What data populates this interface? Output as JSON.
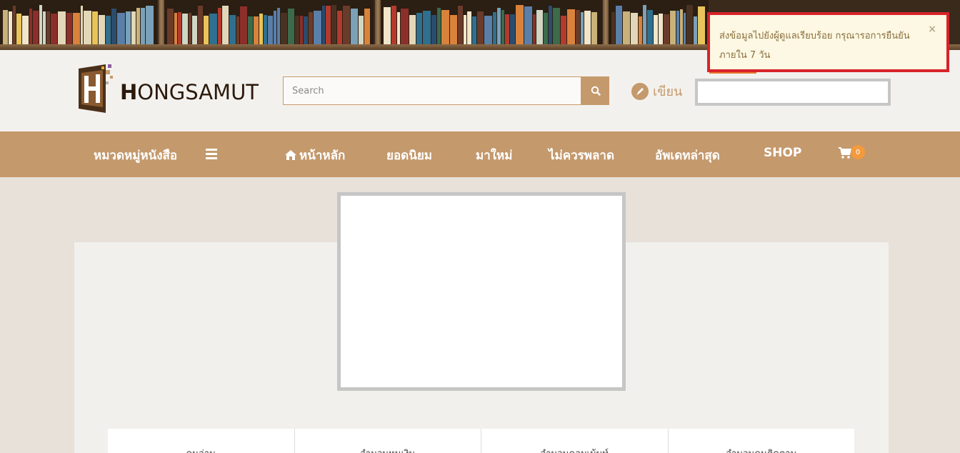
{
  "brand": {
    "logo_text": "HONGSAMUT",
    "logo_letter": "H",
    "logo_rest": "ONGSAMUT"
  },
  "search": {
    "placeholder": "Search"
  },
  "header": {
    "write_label": "เขียน"
  },
  "nav": {
    "categories_label": "หมวดหมู่หนังสือ",
    "items": [
      {
        "label": "หน้าหลัก",
        "icon": "home-icon"
      },
      {
        "label": "ยอดนิยม"
      },
      {
        "label": "มาใหม่"
      },
      {
        "label": "ไม่ควรพลาด"
      },
      {
        "label": "อัพเดทล่าสุด"
      },
      {
        "label": "SHOP"
      }
    ],
    "cart_count": "0"
  },
  "toast": {
    "message": "ส่งข้อมูลไปยังผู้ดูแลเรียบร้อย กรุณารอการยืนยันภายใน 7 วัน",
    "close": "×"
  },
  "stats": {
    "labels": [
      "คนอ่าน",
      "จำนวนหนเงิน",
      "จำนวนคอมเม้นท์",
      "จำนวนคนติดตาม"
    ]
  },
  "colors": {
    "brand": "#c4996c",
    "toast_border": "#d8232a",
    "toast_bg": "#fcf8e3",
    "badge": "#f39a3d"
  }
}
